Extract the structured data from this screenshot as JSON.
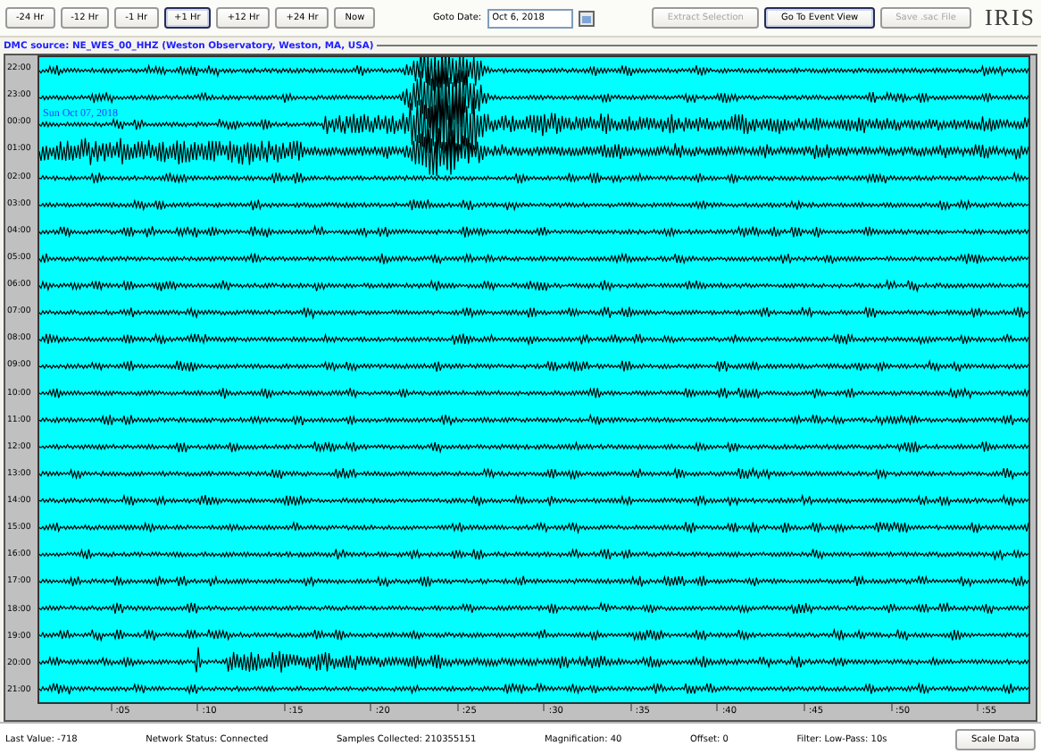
{
  "toolbar": {
    "time_buttons": [
      {
        "label": "-24 Hr",
        "emphasized": false
      },
      {
        "label": "-12 Hr",
        "emphasized": false
      },
      {
        "label": "-1 Hr",
        "emphasized": false
      },
      {
        "label": "+1 Hr",
        "emphasized": true
      },
      {
        "label": "+12 Hr",
        "emphasized": false
      },
      {
        "label": "+24 Hr",
        "emphasized": false
      },
      {
        "label": "Now",
        "emphasized": false
      }
    ],
    "goto_date": {
      "label": "Goto Date:",
      "value": "Oct 6, 2018"
    },
    "action_buttons": [
      {
        "label": "Extract Selection",
        "disabled": true,
        "emphasized": false
      },
      {
        "label": "Go To Event View",
        "disabled": false,
        "emphasized": true
      },
      {
        "label": "Save .sac File",
        "disabled": true,
        "emphasized": false
      }
    ],
    "logo": "IRIS"
  },
  "source_title": "DMC source: NE_WES_00_HHZ (Weston Observatory, Weston, MA, USA)",
  "plot": {
    "date_overlay": "Sun Oct 07, 2018",
    "row_labels": [
      "22:00",
      "23:00",
      "00:00",
      "01:00",
      "02:00",
      "03:00",
      "04:00",
      "05:00",
      "06:00",
      "07:00",
      "08:00",
      "09:00",
      "10:00",
      "11:00",
      "12:00",
      "13:00",
      "14:00",
      "15:00",
      "16:00",
      "17:00",
      "18:00",
      "19:00",
      "20:00",
      "21:00"
    ],
    "x_ticks": [
      ":05",
      ":10",
      ":15",
      ":20",
      ":25",
      ":30",
      ":35",
      ":40",
      ":45",
      ":50",
      ":55"
    ]
  },
  "status_bar": {
    "items": [
      "Last Value: -718",
      "Network Status: Connected",
      "Samples Collected: 210355151",
      "Magnification: 40",
      "Offset: 0",
      "Filter: Low-Pass: 10s"
    ],
    "button": "Scale Data"
  }
}
